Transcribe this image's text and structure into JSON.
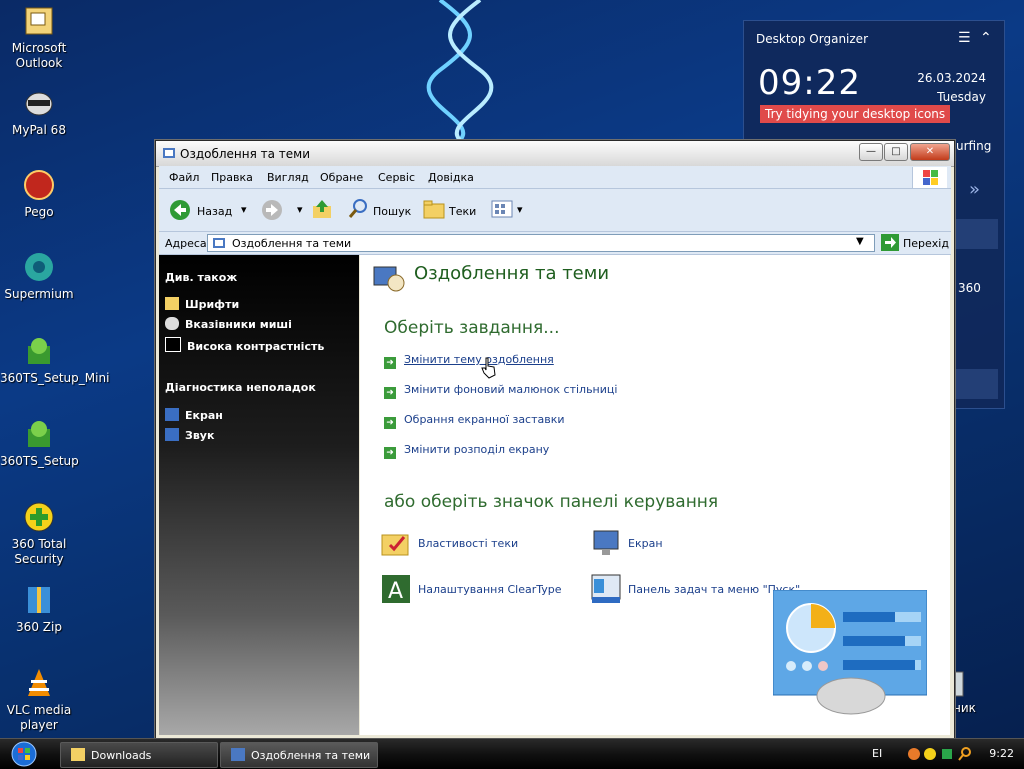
{
  "desktop": {
    "icons": [
      {
        "label": "Microsoft Outlook"
      },
      {
        "label": "MyPal 68"
      },
      {
        "label": "Pego"
      },
      {
        "label": "Supermium"
      },
      {
        "label": "360TS_Setup_Mini"
      },
      {
        "label": "360TS_Setup"
      },
      {
        "label": "360 Total Security"
      },
      {
        "label": "360 Zip"
      },
      {
        "label": "VLC media player"
      }
    ],
    "recycle_partial": "ник"
  },
  "organizer": {
    "title": "Desktop Organizer",
    "time": "09:22",
    "date": "26.03.2024",
    "weekday": "Tuesday",
    "tip": "Try tidying your desktop icons",
    "partial_surfing": "urfing",
    "partial_360": "360"
  },
  "window": {
    "title": "Оздоблення та теми",
    "menu": [
      "Файл",
      "Правка",
      "Вигляд",
      "Обране",
      "Сервіс",
      "Довідка"
    ],
    "toolbar": {
      "back": "Назад",
      "search": "Пошук",
      "folders": "Теки"
    },
    "address": {
      "label": "Адреса:",
      "value": "Оздоблення та теми",
      "go": "Перехід"
    },
    "left": {
      "see_also_header": "Див. також",
      "see_also": [
        "Шрифти",
        "Вказівники миші",
        "Висока контрастність"
      ],
      "troubleshoot_header": "Діагностика неполадок",
      "troubleshoot": [
        "Екран",
        "Звук"
      ]
    },
    "main": {
      "title": "Оздоблення та теми",
      "pick_task": "Оберіть завдання...",
      "tasks": [
        "Змінити тему оздоблення",
        "Змінити фоновий малюнок стільниці",
        "Обрання екранної заставки",
        "Змінити розподіл екрану"
      ],
      "pick_icon": "або оберіть значок панелі керування",
      "icons": [
        "Властивості теки",
        "Екран",
        "Налаштування ClearType",
        "Панель задач та меню \"Пуск\""
      ]
    }
  },
  "taskbar": {
    "items": [
      "Downloads",
      "Оздоблення та теми"
    ],
    "lang": "EI",
    "clock": "9:22"
  }
}
